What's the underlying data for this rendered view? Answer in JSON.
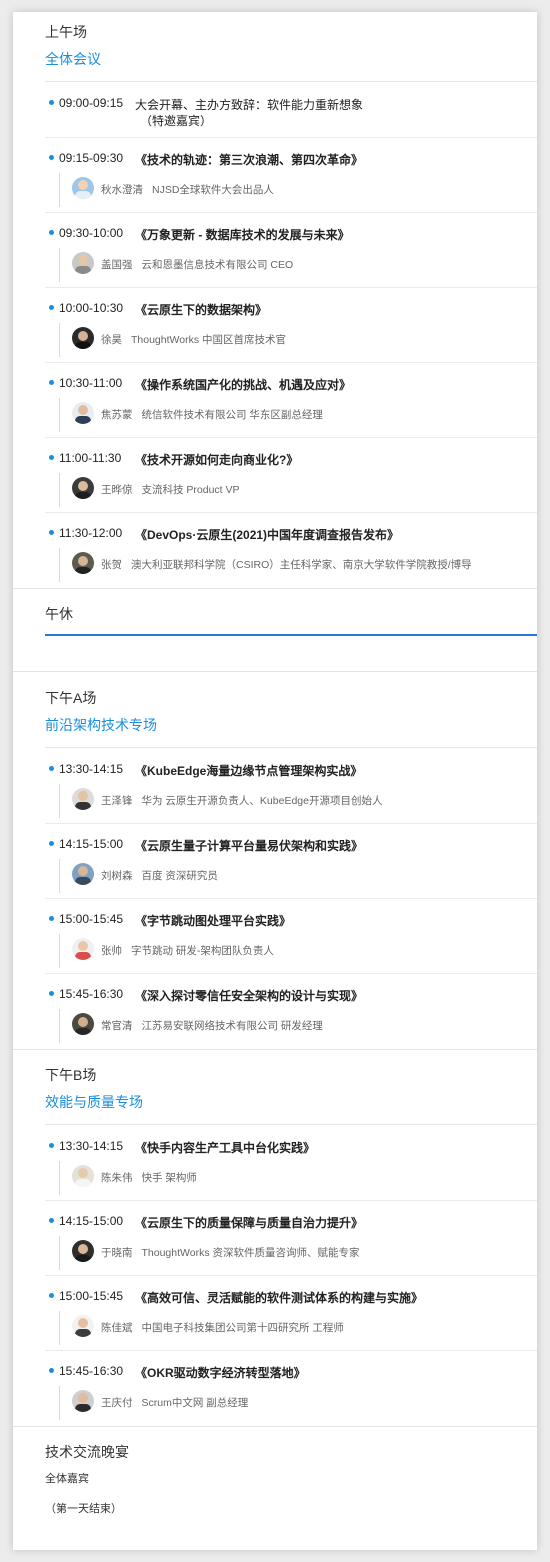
{
  "morning": {
    "title": "上午场",
    "subtitle": "全体会议",
    "items": [
      {
        "time": "09:00-09:15",
        "title": "大会开幕、主办方致辞：软件能力重新想象",
        "title2": "（特邀嘉宾）",
        "speaker": "",
        "role": ""
      },
      {
        "time": "09:15-09:30",
        "title": "《技术的轨迹：第三次浪潮、第四次革命》",
        "speaker": "秋水澄清",
        "role": "NJSD全球软件大会出品人"
      },
      {
        "time": "09:30-10:00",
        "title": "《万象更新 - 数据库技术的发展与未来》",
        "speaker": "盖国强",
        "role": "云和恩墨信息技术有限公司 CEO"
      },
      {
        "time": "10:00-10:30",
        "title": "《云原生下的数据架构》",
        "speaker": "徐昊",
        "role": "ThoughtWorks 中国区首席技术官"
      },
      {
        "time": "10:30-11:00",
        "title": "《操作系统国产化的挑战、机遇及应对》",
        "speaker": "焦苏蒙",
        "role": "统信软件技术有限公司 华东区副总经理"
      },
      {
        "time": "11:00-11:30",
        "title": "《技术开源如何走向商业化?》",
        "speaker": "王晔倞",
        "role": "支流科技 Product VP"
      },
      {
        "time": "11:30-12:00",
        "title": "《DevOps·云原生(2021)中国年度调查报告发布》",
        "speaker": "张贺",
        "role": "澳大利亚联邦科学院（CSIRO）主任科学家、南京大学软件学院教授/博导"
      }
    ]
  },
  "lunch": {
    "title": "午休"
  },
  "afternoonA": {
    "title": "下午A场",
    "subtitle": "前沿架构技术专场",
    "items": [
      {
        "time": "13:30-14:15",
        "title": "《KubeEdge海量边缘节点管理架构实战》",
        "speaker": "王泽锋",
        "role": "华为 云原生开源负责人、KubeEdge开源项目创始人"
      },
      {
        "time": "14:15-15:00",
        "title": "《云原生量子计算平台量易伏架构和实践》",
        "speaker": "刘树森",
        "role": "百度 资深研究员"
      },
      {
        "time": "15:00-15:45",
        "title": "《字节跳动图处理平台实践》",
        "speaker": "张帅",
        "role": "字节跳动 研发-架构团队负责人"
      },
      {
        "time": "15:45-16:30",
        "title": "《深入探讨零信任安全架构的设计与实现》",
        "speaker": "常官清",
        "role": "江苏易安联网络技术有限公司 研发经理"
      }
    ]
  },
  "afternoonB": {
    "title": "下午B场",
    "subtitle": "效能与质量专场",
    "items": [
      {
        "time": "13:30-14:15",
        "title": "《快手内容生产工具中台化实践》",
        "speaker": "陈朱伟",
        "role": "快手 架构师"
      },
      {
        "time": "14:15-15:00",
        "title": "《云原生下的质量保障与质量自治力提升》",
        "speaker": "于晓南",
        "role": "ThoughtWorks 资深软件质量咨询师、赋能专家"
      },
      {
        "time": "15:00-15:45",
        "title": "《高效可信、灵活赋能的软件测试体系的构建与实施》",
        "speaker": "陈佳斌",
        "role": "中国电子科技集团公司第十四研究所 工程师"
      },
      {
        "time": "15:45-16:30",
        "title": "《OKR驱动数字经济转型落地》",
        "speaker": "王庆付",
        "role": "Scrum中文网 副总经理"
      }
    ]
  },
  "dinner": {
    "title": "技术交流晚宴",
    "subtitle": "全体嘉宾",
    "note": "（第一天结束）"
  },
  "colors": {
    "accent": "#1a8fe0",
    "line": "#2b78d6"
  }
}
